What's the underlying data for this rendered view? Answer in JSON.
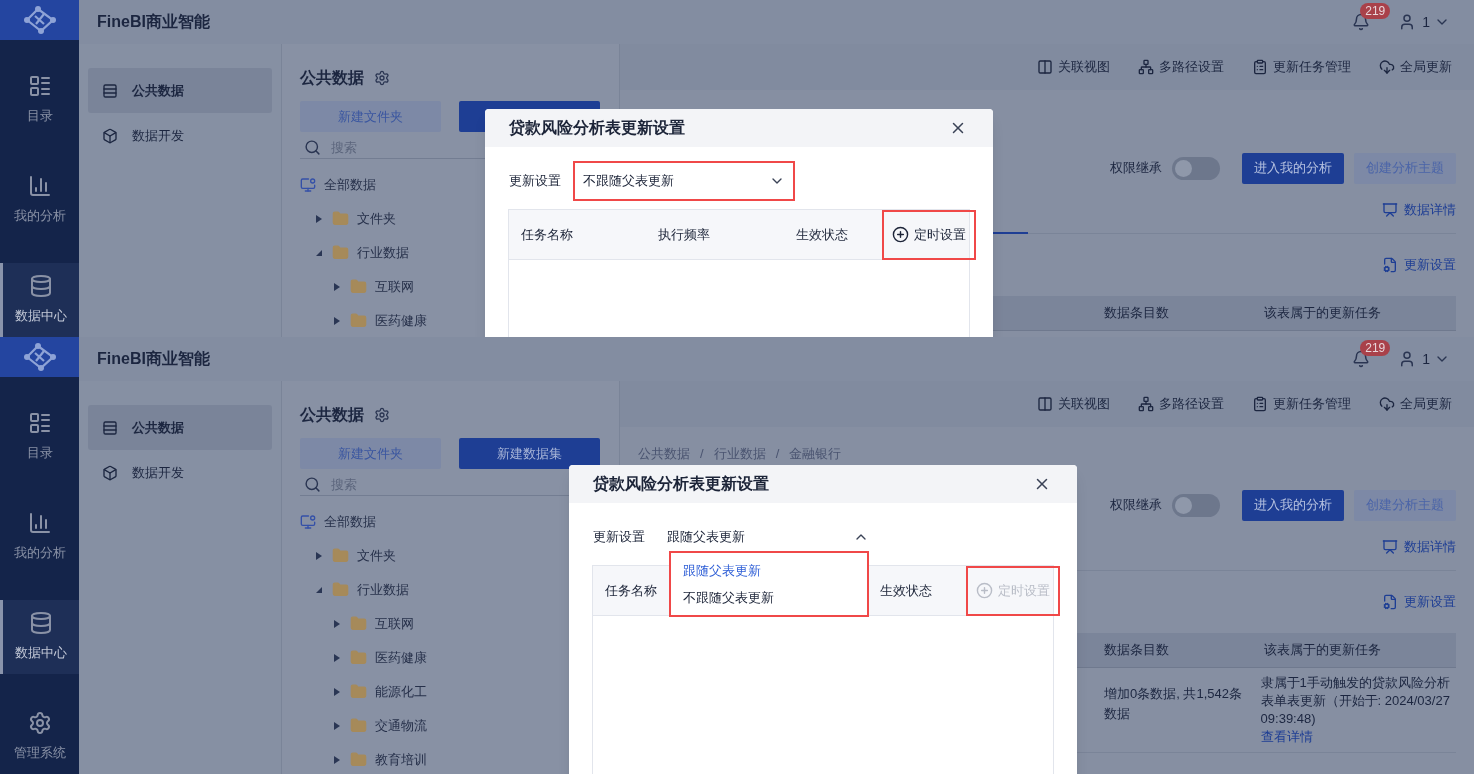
{
  "panels": [
    {
      "app_title": "FineBI商业智能",
      "notification_count": "219",
      "user": "1",
      "rail": [
        {
          "label": "目录",
          "selected": false
        },
        {
          "label": "我的分析",
          "selected": false
        },
        {
          "label": "数据中心",
          "selected": true
        }
      ],
      "nav": [
        {
          "label": "公共数据",
          "selected": true
        },
        {
          "label": "数据开发",
          "selected": false
        }
      ],
      "tree_panel": {
        "title": "公共数据",
        "buttons": [
          {
            "label": "新建文件夹",
            "kind": "secondary"
          },
          {
            "kind": "primary"
          }
        ],
        "search_placeholder": "搜索",
        "tree": [
          {
            "label": "全部数据",
            "kind": "root",
            "expanded": true,
            "children": [
              {
                "label": "文件夹",
                "expanded": false
              },
              {
                "label": "行业数据",
                "expanded": true,
                "children": [
                  {
                    "label": "互联网",
                    "expanded": false
                  },
                  {
                    "label": "医药健康",
                    "expanded": false
                  }
                ]
              }
            ]
          }
        ]
      },
      "toolbar": [
        "关联视图",
        "多路径设置",
        "更新任务管理",
        "全局更新"
      ],
      "permission": {
        "label": "权限继承",
        "on": false
      },
      "actions": [
        {
          "label": "进入我的分析",
          "kind": "primary"
        },
        {
          "label": "创建分析主题",
          "kind": "secondary"
        }
      ],
      "data_detail": "数据详情",
      "update_settings": "更新设置",
      "table": {
        "columns": [
          "数据条目数",
          "该表属于的更新任务"
        ]
      },
      "dialog": {
        "title": "贷款风险分析表更新设置",
        "field_label": "更新设置",
        "select": {
          "value": "不跟随父表更新",
          "expanded": false,
          "highlighted": true
        },
        "columns": [
          {
            "label": "任务名称",
            "kind": "name"
          },
          {
            "label": "执行频率",
            "kind": "frequency"
          },
          {
            "label": "生效状态",
            "kind": "status"
          }
        ],
        "schedule_button": {
          "label": "定时设置",
          "disabled": false,
          "highlighted": true
        }
      }
    },
    {
      "app_title": "FineBI商业智能",
      "notification_count": "219",
      "user": "1",
      "rail": [
        {
          "label": "目录",
          "selected": false
        },
        {
          "label": "我的分析",
          "selected": false
        },
        {
          "label": "数据中心",
          "selected": true
        },
        {
          "label": "管理系统",
          "selected": false
        }
      ],
      "nav": [
        {
          "label": "公共数据",
          "selected": true
        },
        {
          "label": "数据开发",
          "selected": false
        }
      ],
      "tree_panel": {
        "title": "公共数据",
        "buttons": [
          {
            "label": "新建文件夹",
            "kind": "secondary"
          },
          {
            "label": "新建数据集",
            "kind": "primary"
          }
        ],
        "search_placeholder": "搜索",
        "tree": [
          {
            "label": "全部数据",
            "kind": "root",
            "expanded": true,
            "children": [
              {
                "label": "文件夹",
                "expanded": false
              },
              {
                "label": "行业数据",
                "expanded": true,
                "children": [
                  {
                    "label": "互联网",
                    "expanded": false
                  },
                  {
                    "label": "医药健康",
                    "expanded": false
                  },
                  {
                    "label": "能源化工",
                    "expanded": false
                  },
                  {
                    "label": "交通物流",
                    "expanded": false
                  },
                  {
                    "label": "教育培训",
                    "expanded": false
                  }
                ]
              }
            ]
          }
        ]
      },
      "toolbar": [
        "关联视图",
        "多路径设置",
        "更新任务管理",
        "全局更新"
      ],
      "breadcrumb": {
        "items": [
          "公共数据",
          "行业数据",
          "金融银行"
        ],
        "separator": "/"
      },
      "permission": {
        "label": "权限继承",
        "on": false
      },
      "actions": [
        {
          "label": "进入我的分析",
          "kind": "primary"
        },
        {
          "label": "创建分析主题",
          "kind": "secondary"
        }
      ],
      "data_detail": "数据详情",
      "update_settings": "更新设置",
      "table": {
        "columns": [
          "数据条目数",
          "该表属于的更新任务"
        ],
        "rows": [
          {
            "cells": [
              "增加0条数据, 共1,542条数据",
              "隶属于1手动触发的贷款风险分析表单表更新（开始于: 2024/03/27 09:39:48)"
            ],
            "link": "查看详情"
          }
        ]
      },
      "dialog": {
        "title": "贷款风险分析表更新设置",
        "field_label": "更新设置",
        "select": {
          "value": "跟随父表更新",
          "expanded": true,
          "highlighted": false
        },
        "options": [
          {
            "label": "跟随父表更新",
            "selected": true
          },
          {
            "label": "不跟随父表更新",
            "selected": false
          }
        ],
        "options_highlighted": true,
        "columns": [
          {
            "label": "任务名称",
            "kind": "name"
          },
          {
            "label": "生效状态",
            "kind": "status"
          }
        ],
        "schedule_button": {
          "label": "定时设置",
          "disabled": true,
          "highlighted": true
        }
      }
    }
  ]
}
